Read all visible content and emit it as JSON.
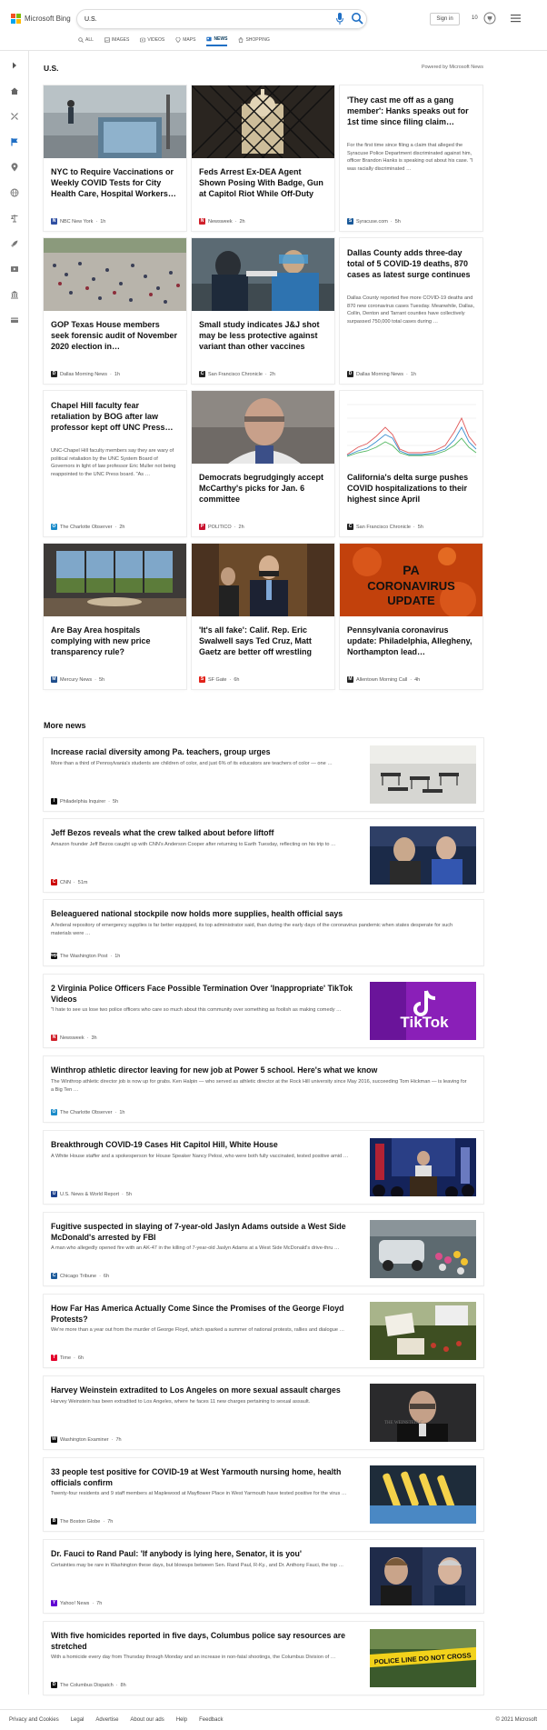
{
  "header": {
    "logo_text": "Microsoft Bing",
    "logo_colors": [
      "#f25022",
      "#7fba00",
      "#00a4ef",
      "#ffb900"
    ],
    "search_value": "U.S.",
    "signin_label": "Sign in",
    "rewards_count": "10",
    "accent": "#1f6fc5"
  },
  "nav": [
    {
      "label": "ALL",
      "icon": "search-icon"
    },
    {
      "label": "IMAGES",
      "icon": "images-icon"
    },
    {
      "label": "VIDEOS",
      "icon": "videos-icon"
    },
    {
      "label": "MAPS",
      "icon": "maps-icon"
    },
    {
      "label": "NEWS",
      "icon": "news-icon",
      "active": true
    },
    {
      "label": "SHOPPING",
      "icon": "shopping-icon"
    }
  ],
  "rail": [
    "expand-icon",
    "home-icon",
    "tools-icon",
    "flag-icon",
    "location-icon",
    "globe-icon",
    "scale-icon",
    "rocket-icon",
    "film-icon",
    "bank-icon",
    "card-icon"
  ],
  "section": {
    "title": "U.S.",
    "powered": "Powered by Microsoft News"
  },
  "cards": [
    {
      "title": "NYC to Require Vaccinations or Weekly COVID Tests for City Health Care, Hospital Workers…",
      "provider": "NBC New York",
      "time": "1h",
      "logo_color": "#2f4fa2",
      "logo_letter": "N",
      "img": "nyc"
    },
    {
      "title": "Feds Arrest Ex-DEA Agent Shown Posing With Badge, Gun at Capitol Riot While Off-Duty",
      "provider": "Newsweek",
      "time": "2h",
      "logo_color": "#d0202a",
      "logo_letter": "N",
      "img": "capitol"
    },
    {
      "title": "'They cast me off as a gang member': Hanks speaks out for 1st time since filing claim…",
      "snippet": "For the first time since filing a claim that alleged the Syracuse Police Department discriminated against him, officer Brandon Hanks is speaking out about his case. \"I was racially discriminated …",
      "provider": "Syracuse.com",
      "time": "5h",
      "logo_color": "#1b5a9a",
      "logo_letter": "S"
    },
    {
      "title": "GOP Texas House members seek forensic audit of November 2020 election in…",
      "provider": "Dallas Morning News",
      "time": "1h",
      "logo_color": "#222",
      "logo_letter": "D",
      "img": "crowd"
    },
    {
      "title": "Small study indicates J&J shot may be less protective against variant than other vaccines",
      "provider": "San Francisco Chronicle",
      "time": "2h",
      "logo_color": "#222",
      "logo_letter": "C",
      "img": "swab"
    },
    {
      "title": "Dallas County adds three-day total of 5 COVID-19 deaths, 870 cases as latest surge continues",
      "snippet": "Dallas County reported five more COVID-19 deaths and 870 new coronavirus cases Tuesday. Meanwhile, Dallas, Collin, Denton and Tarrant counties have collectively surpassed 750,000 total cases during …",
      "provider": "Dallas Morning News",
      "time": "1h",
      "logo_color": "#222",
      "logo_letter": "D"
    },
    {
      "title": "Chapel Hill faculty fear retaliation by BOG after law professor kept off UNC Press…",
      "snippet": "UNC-Chapel Hill faculty members say they are wary of political retaliation by the UNC System Board of Governors in light of law professor Eric Muller not being reappointed to the UNC Press board. \"As …",
      "provider": "The Charlotte Observer",
      "time": "2h",
      "logo_color": "#1a8bc9",
      "logo_letter": "O"
    },
    {
      "title": "Democrats begrudgingly accept McCarthy's picks for Jan. 6 committee",
      "provider": "POLITICO",
      "time": "2h",
      "logo_color": "#c8102e",
      "logo_letter": "P",
      "img": "portrait"
    },
    {
      "title": "California's delta surge pushes COVID hospitalizations to their highest since April",
      "provider": "San Francisco Chronicle",
      "time": "5h",
      "logo_color": "#222",
      "logo_letter": "C",
      "img": "chart"
    },
    {
      "title": "Are Bay Area hospitals complying with new price transparency rule?",
      "provider": "Mercury News",
      "time": "5h",
      "logo_color": "#1f4e8c",
      "logo_letter": "M",
      "img": "office"
    },
    {
      "title": "'It's all fake': Calif. Rep. Eric Swalwell says Ted Cruz, Matt Gaetz are better off wrestling",
      "provider": "SF Gate",
      "time": "6h",
      "logo_color": "#e2231a",
      "logo_letter": "S",
      "img": "hallway"
    },
    {
      "title": "Pennsylvania coronavirus update: Philadelphia, Allegheny, Northampton lead…",
      "provider": "Allentown Morning Call",
      "time": "4h",
      "logo_color": "#222",
      "logo_letter": "M",
      "img": "virus",
      "img_text_1": "PA",
      "img_text_2": "CORONAVIRUS",
      "img_text_3": "UPDATE"
    }
  ],
  "more_news_title": "More news",
  "more_news": [
    {
      "title": "Increase racial diversity among Pa. teachers, group urges",
      "snippet": "More than a third of Pennsylvania's students are children of color, and just 6% of its educators are teachers of color — one …",
      "provider": "Philadelphia Inquirer",
      "time": "5h",
      "logo_color": "#111",
      "logo_letter": "I",
      "img": "classroom"
    },
    {
      "title": "Jeff Bezos reveals what the crew talked about before liftoff",
      "snippet": "Amazon founder Jeff Bezos caught up with CNN's Anderson Cooper after returning to Earth Tuesday, reflecting on his trip to …",
      "provider": "CNN",
      "time": "51m",
      "logo_color": "#cc0000",
      "logo_letter": "C",
      "img": "bezos"
    },
    {
      "title": "Beleaguered national stockpile now holds more supplies, health official says",
      "snippet": "A federal repository of emergency supplies is far better equipped, its top administrator said, than during the early days of the coronavirus pandemic when states desperate for such materials were …",
      "provider": "The Washington Post",
      "time": "1h",
      "logo_color": "#111",
      "logo_letter": "wp"
    },
    {
      "title": "2 Virginia Police Officers Face Possible Termination Over 'Inappropriate' TikTok Videos",
      "snippet": "\"I hate to see us lose two police officers who care so much about this community over something as foolish as making comedy …",
      "provider": "Newsweek",
      "time": "3h",
      "logo_color": "#d0202a",
      "logo_letter": "N",
      "img": "tiktok",
      "img_text": "TikTok"
    },
    {
      "title": "Winthrop athletic director leaving for new job at Power 5 school. Here's what we know",
      "snippet": "The Winthrop athletic director job is now up for grabs. Ken Halpin — who served as athletic director at the Rock Hill university since May 2016, succeeding Tom Hickman — is leaving for a Big Ten …",
      "provider": "The Charlotte Observer",
      "time": "1h",
      "logo_color": "#1a8bc9",
      "logo_letter": "O"
    },
    {
      "title": "Breakthrough COVID-19 Cases Hit Capitol Hill, White House",
      "snippet": "A White House staffer and a spokesperson for House Speaker Nancy Pelosi, who were both fully vaccinated, tested positive amid …",
      "provider": "U.S. News & World Report",
      "time": "5h",
      "logo_color": "#1b3f8b",
      "logo_letter": "U",
      "img": "briefing"
    },
    {
      "title": "Fugitive suspected in slaying of 7-year-old Jaslyn Adams outside a West Side McDonald's arrested by FBI",
      "snippet": "A man who allegedly opened fire with an AK-47 in the killing of 7-year-old Jaslyn Adams at a West Side McDonald's drive-thru …",
      "provider": "Chicago Tribune",
      "time": "6h",
      "logo_color": "#1b5a9a",
      "logo_letter": "C",
      "img": "memorial"
    },
    {
      "title": "How Far Has America Actually Come Since the Promises of the George Floyd Protests?",
      "snippet": "We're more than a year out from the murder of George Floyd, which sparked a summer of national protests, rallies and dialogue …",
      "provider": "Time",
      "time": "6h",
      "logo_color": "#e4002b",
      "logo_letter": "T",
      "img": "protest"
    },
    {
      "title": "Harvey Weinstein extradited to Los Angeles on more sexual assault charges",
      "snippet": "Harvey Weinstein has been extradited to Los Angeles, where he faces 11 new charges pertaining to sexual assault.",
      "provider": "Washington Examiner",
      "time": "7h",
      "logo_color": "#111",
      "logo_letter": "W",
      "img": "weinstein"
    },
    {
      "title": "33 people test positive for COVID-19 at West Yarmouth nursing home, health officials confirm",
      "snippet": "Twenty-four residents and 9 staff members at Maplewood at Mayflower Place in West Yarmouth have tested positive for the virus …",
      "provider": "The Boston Globe",
      "time": "7h",
      "logo_color": "#111",
      "logo_letter": "B",
      "img": "tubes"
    },
    {
      "title": "Dr. Fauci to Rand Paul: 'If anybody is lying here, Senator, it is you'",
      "snippet": "Certainties may be rare in Washington these days, but blowups between Sen. Rand Paul, R-Ky., and Dr. Anthony Fauci, the top …",
      "provider": "Yahoo! News",
      "time": "7h",
      "logo_color": "#6001d2",
      "logo_letter": "Y",
      "img": "fauci"
    },
    {
      "title": "With five homicides reported in five days, Columbus police say resources are stretched",
      "snippet": "With a homicide every day from Thursday through Monday and an increase in non-fatal shootings, the Columbus Division of …",
      "provider": "The Columbus Dispatch",
      "time": "8h",
      "logo_color": "#111",
      "logo_letter": "D",
      "img": "tape",
      "img_text": "POLICE LINE DO NOT CROSS"
    }
  ],
  "footer": {
    "links": [
      "Privacy and Cookies",
      "Legal",
      "Advertise",
      "About our ads",
      "Help",
      "Feedback"
    ],
    "copyright": "© 2021 Microsoft"
  }
}
